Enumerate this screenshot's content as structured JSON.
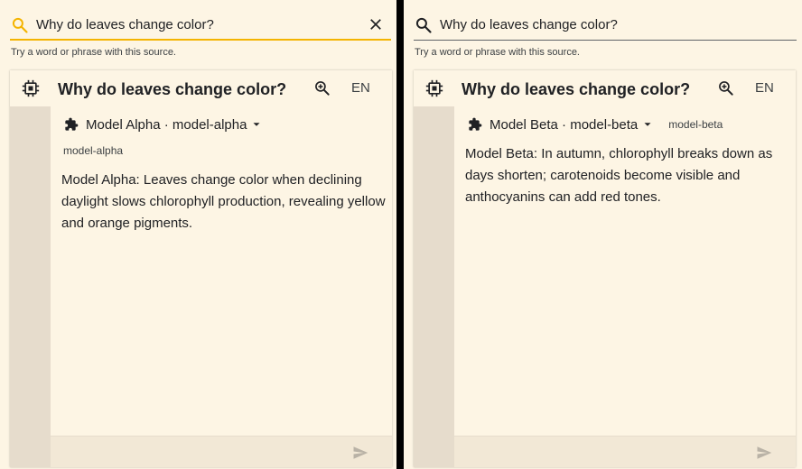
{
  "panes": [
    {
      "search": {
        "query": "Why do leaves change color?",
        "has_clear": true,
        "icon": "search-icon",
        "icon_color": "#f4b400"
      },
      "hint": "Try a word or phrase with this source.",
      "card": {
        "title": "Why do leaves change color?",
        "lang": "EN",
        "model": {
          "name": "Model Alpha · model-alpha",
          "tag": "model-alpha"
        },
        "answer": "Model Alpha: Leaves change color when declining daylight slows chlorophyll production, revealing yellow and orange pigments."
      }
    },
    {
      "search": {
        "query": "Why do leaves change color?",
        "has_clear": false,
        "icon": "search-icon",
        "icon_color": "#202124"
      },
      "hint": "Try a word or phrase with this source.",
      "card": {
        "title": "Why do leaves change color?",
        "lang": "EN",
        "model": {
          "name": "Model Beta · model-beta",
          "tag": "model-beta"
        },
        "answer": "Model Beta: In autumn, chlorophyll breaks down as days shorten; carotenoids become visible and anthocyanins can add red tones."
      }
    }
  ],
  "colors": {
    "accent": "#f4b400",
    "background": "#fdf5e4",
    "rail": "#e6dccc",
    "divider": "#000000"
  }
}
